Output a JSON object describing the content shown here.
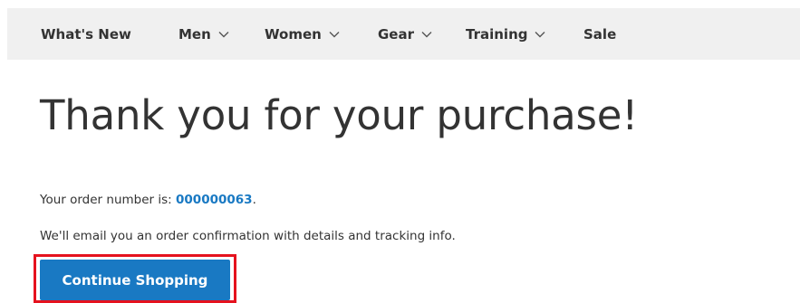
{
  "nav": {
    "items": [
      {
        "label": "What's New",
        "has_dropdown": false
      },
      {
        "label": "Men",
        "has_dropdown": true
      },
      {
        "label": "Women",
        "has_dropdown": true
      },
      {
        "label": "Gear",
        "has_dropdown": true
      },
      {
        "label": "Training",
        "has_dropdown": true
      },
      {
        "label": "Sale",
        "has_dropdown": false
      }
    ],
    "dropdown_icon": "chevron-down-icon"
  },
  "main": {
    "title": "Thank you for your purchase!",
    "order_prefix": "Your order number is: ",
    "order_number": "000000063",
    "order_suffix": ".",
    "email_message": "We'll email you an order confirmation with details and tracking info.",
    "continue_label": "Continue Shopping"
  },
  "colors": {
    "accent": "#1979c3",
    "nav_background": "#f0f0f0",
    "highlight": "#e5121e",
    "text": "#333333"
  }
}
